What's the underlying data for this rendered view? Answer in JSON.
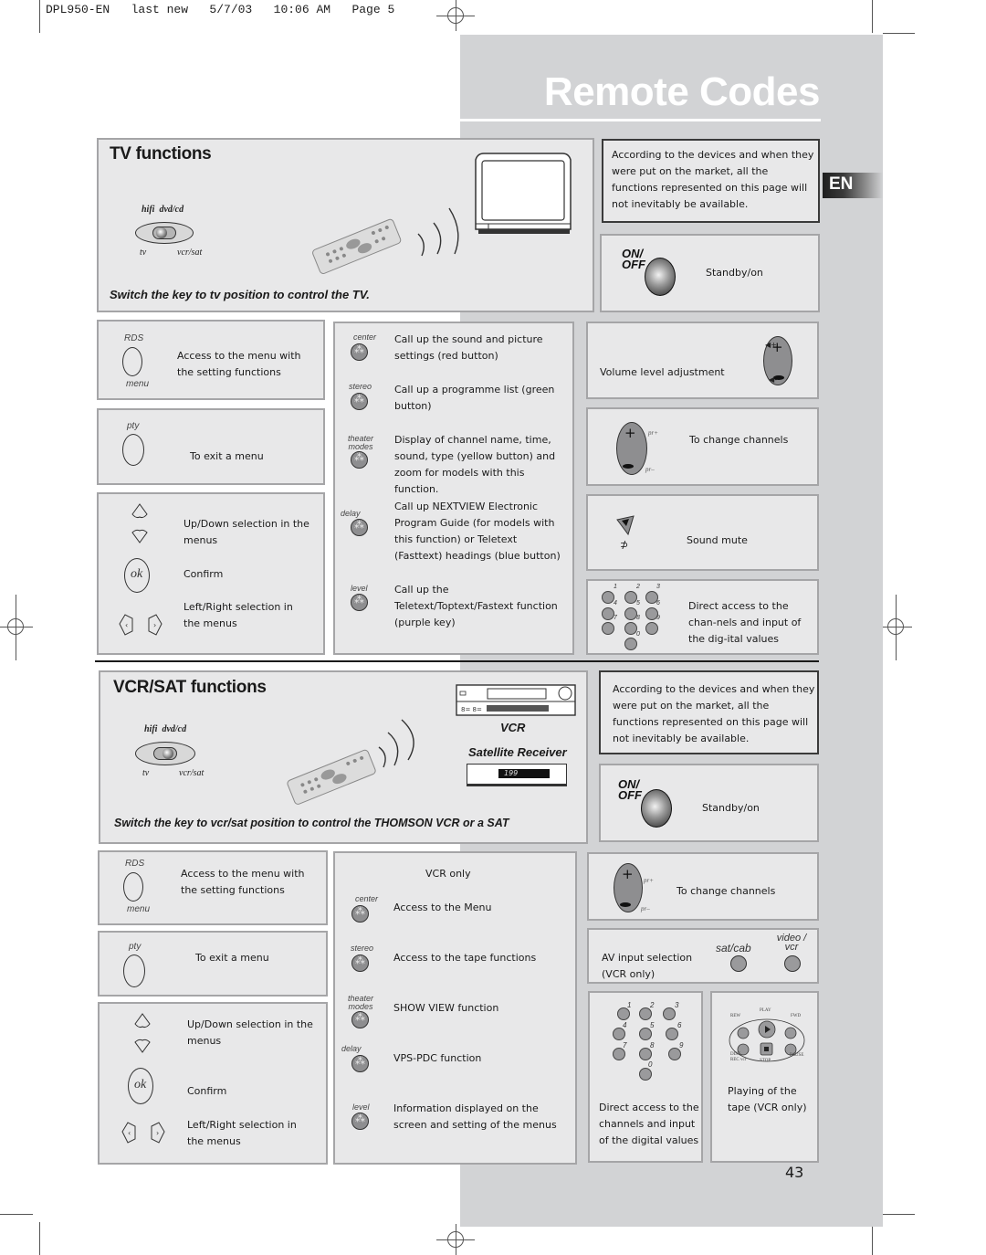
{
  "print_slug": "DPL950-EN   last new   5/7/03   10:06 AM   Page 5",
  "page": {
    "title": "Remote Codes",
    "language_tab": "EN",
    "page_number": "43"
  },
  "tv_section": {
    "title": "TV functions",
    "switch_labels": {
      "top": "hifi  dvd/cd",
      "bottom_left": "tv",
      "bottom_right": "vcr/sat"
    },
    "instruction": "Switch the key to tv position to control the TV.",
    "notice": "According to the devices and when they were put on the market, all the functions represented on this page will not inevitably be available.",
    "standby": {
      "key_label_1": "ON/",
      "key_label_2": "OFF",
      "text": "Standby/on"
    },
    "menu": {
      "key_top": "RDS",
      "key_bottom": "menu",
      "text": "Access to the menu with the setting functions"
    },
    "exit": {
      "key_top": "pty",
      "text": "To exit a menu"
    },
    "navigation": {
      "updown": "Up/Down selection in the menus",
      "ok_key": "ok",
      "confirm": "Confirm",
      "leftright": "Left/Right selection in the menus"
    },
    "color_keys": [
      {
        "key": "center",
        "text": "Call up the sound and picture settings (red button)"
      },
      {
        "key": "stereo",
        "text": "Call up a programme list (green button)"
      },
      {
        "key": "theater modes",
        "text": "Display of channel name, time, sound, type (yellow button) and zoom for models with this function."
      },
      {
        "key": "delay",
        "text": "Call up NEXTVIEW Electronic Program Guide (for models with this function) or Teletext (Fasttext) headings (blue button)"
      },
      {
        "key": "level",
        "text": "Call up the Teletext/Toptext/Fastext function (purple key)"
      }
    ],
    "volume": "Volume level adjustment",
    "channels": {
      "text": "To change channels",
      "plus": "pr+",
      "minus": "pr–"
    },
    "mute": "Sound mute",
    "digits": {
      "text": "Direct access to the chan-nels and input of the dig-ital values",
      "keys": [
        "1",
        "2",
        "3",
        "4",
        "5",
        "6",
        "7",
        "8",
        "9",
        "0"
      ]
    }
  },
  "vcr_section": {
    "title": "VCR/SAT functions",
    "switch_labels": {
      "top": "hifi  dvd/cd",
      "bottom_left": "tv",
      "bottom_right": "vcr/sat"
    },
    "vcr_label": "VCR",
    "sat_label": "Satellite Receiver",
    "sat_display": "199",
    "instruction": "Switch the key to vcr/sat position to control the THOMSON VCR or a SAT",
    "notice": "According to the devices and when they were put on the market, all the functions represented on this page will not inevitably be available.",
    "standby": {
      "key_label_1": "ON/",
      "key_label_2": "OFF",
      "text": "Standby/on"
    },
    "menu": {
      "key_top": "RDS",
      "key_bottom": "menu",
      "text": "Access to the menu with the setting functions"
    },
    "exit": {
      "key_top": "pty",
      "text": "To exit a menu"
    },
    "navigation": {
      "updown": "Up/Down selection in the menus",
      "ok_key": "ok",
      "confirm": "Confirm",
      "leftright": "Left/Right selection in the menus"
    },
    "vcr_only_heading": "VCR only",
    "color_keys": [
      {
        "key": "center",
        "text": "Access to the Menu"
      },
      {
        "key": "stereo",
        "text": "Access to the tape functions"
      },
      {
        "key": "theater modes",
        "text": "SHOW VIEW function"
      },
      {
        "key": "delay",
        "text": "VPS-PDC function"
      },
      {
        "key": "level",
        "text": "Information displayed on the screen and setting of the menus"
      }
    ],
    "channels": {
      "text": "To change channels",
      "plus": "pr+",
      "minus": "pr–"
    },
    "av_input": {
      "text": "AV input selection (VCR only)",
      "key1": "sat/cab",
      "key2": "video / vcr"
    },
    "digits": {
      "text": "Direct access to the channels and input of the digital values",
      "keys": [
        "1",
        "2",
        "3",
        "4",
        "5",
        "6",
        "7",
        "8",
        "9",
        "0"
      ]
    },
    "playback": {
      "text": "Playing of the tape (VCR only)",
      "keys": {
        "rew": "REW",
        "play": "PLAY",
        "fwd": "FWD",
        "rec": "DISC REC vcr",
        "stop": "STOP",
        "pause": "PAUSE"
      }
    }
  }
}
